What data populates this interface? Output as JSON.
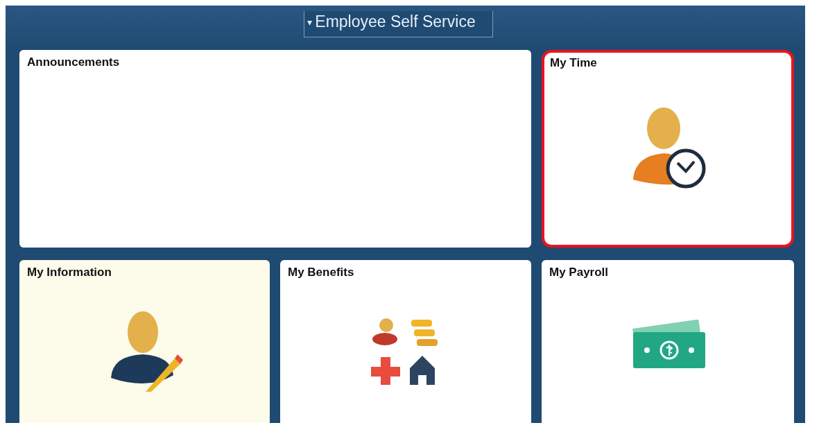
{
  "header": {
    "title": "Employee Self Service",
    "caret": "▾"
  },
  "tiles": [
    {
      "title": "Announcements",
      "kind": "blank",
      "focused": false,
      "hovered": false,
      "wide": true
    },
    {
      "title": "My Time",
      "kind": "time",
      "focused": true,
      "hovered": false,
      "wide": false
    },
    {
      "title": "My Information",
      "kind": "info",
      "focused": false,
      "hovered": true,
      "wide": false
    },
    {
      "title": "My Benefits",
      "kind": "benefits",
      "focused": false,
      "hovered": false,
      "wide": false
    },
    {
      "title": "My Payroll",
      "kind": "payroll",
      "focused": false,
      "hovered": false,
      "wide": false
    }
  ]
}
